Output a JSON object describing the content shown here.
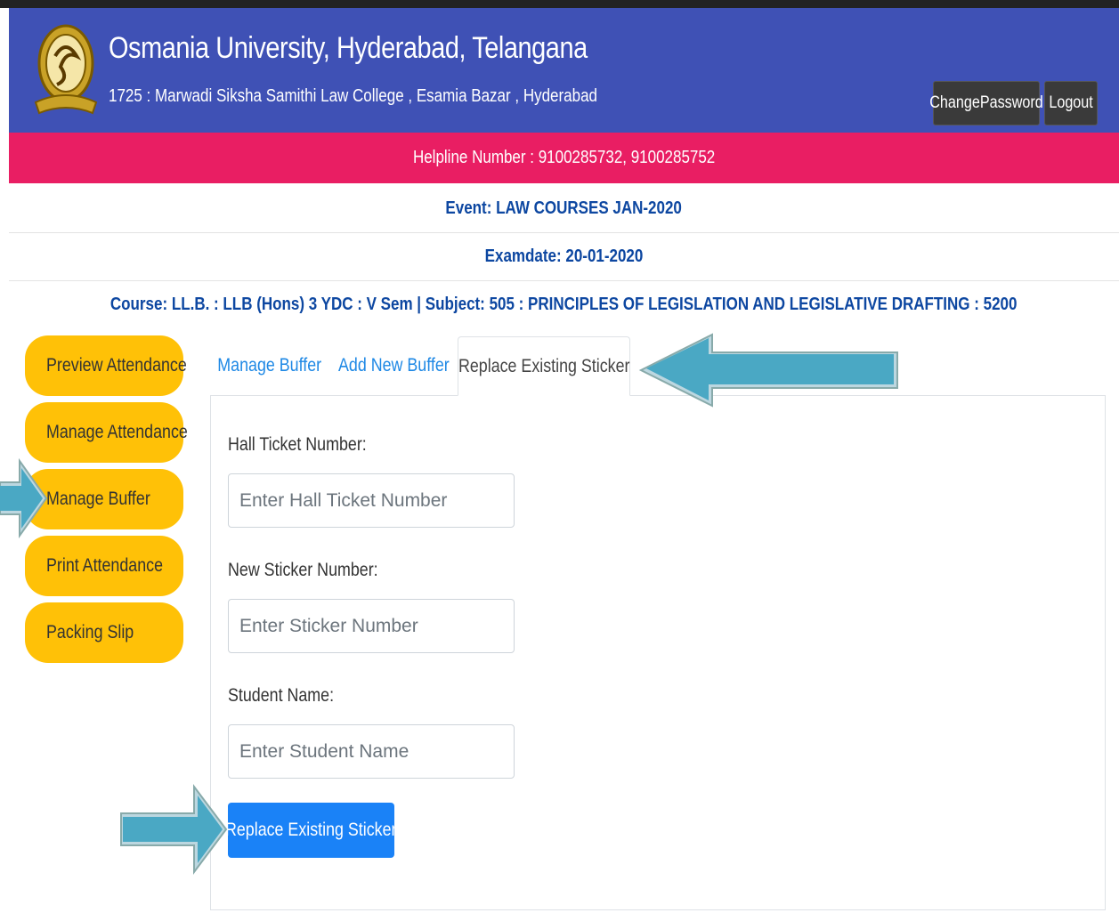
{
  "header": {
    "university": "Osmania University, Hyderabad, Telangana",
    "college": "1725 : Marwadi Siksha Samithi Law College , Esamia Bazar , Hyderabad",
    "change_password": "ChangePassword",
    "logout": "Logout",
    "bg_color": "#3f51b5"
  },
  "helpline": {
    "text": "Helpline Number : 9100285732, 9100285752",
    "bg_color": "#e91e63"
  },
  "info": {
    "event": "Event: LAW COURSES JAN-2020",
    "examdate": "Examdate: 20-01-2020",
    "course": "Course: LL.B. : LLB (Hons) 3 YDC : V Sem | Subject: 505 : PRINCIPLES OF LEGISLATION AND LEGISLATIVE DRAFTING : 5200"
  },
  "sidebar": {
    "items": [
      {
        "label": "Preview Attendance"
      },
      {
        "label": "Manage Attendance"
      },
      {
        "label": "Manage Buffer"
      },
      {
        "label": "Print Attendance"
      },
      {
        "label": "Packing Slip"
      }
    ],
    "color": "#ffc107"
  },
  "tabs": [
    {
      "label": "Manage Buffer",
      "active": false
    },
    {
      "label": "Add New Buffer",
      "active": false
    },
    {
      "label": "Replace Existing Sticker",
      "active": true
    }
  ],
  "form": {
    "hall_ticket_label": "Hall Ticket Number:",
    "hall_ticket_placeholder": "Enter Hall Ticket Number",
    "sticker_label": "New Sticker Number:",
    "sticker_placeholder": "Enter Sticker Number",
    "name_label": "Student Name:",
    "name_placeholder": "Enter Student Name",
    "submit": "Replace Existing Sticker",
    "submit_color": "#1a82f7"
  },
  "annotation_arrow_color": "#4aa8c4"
}
